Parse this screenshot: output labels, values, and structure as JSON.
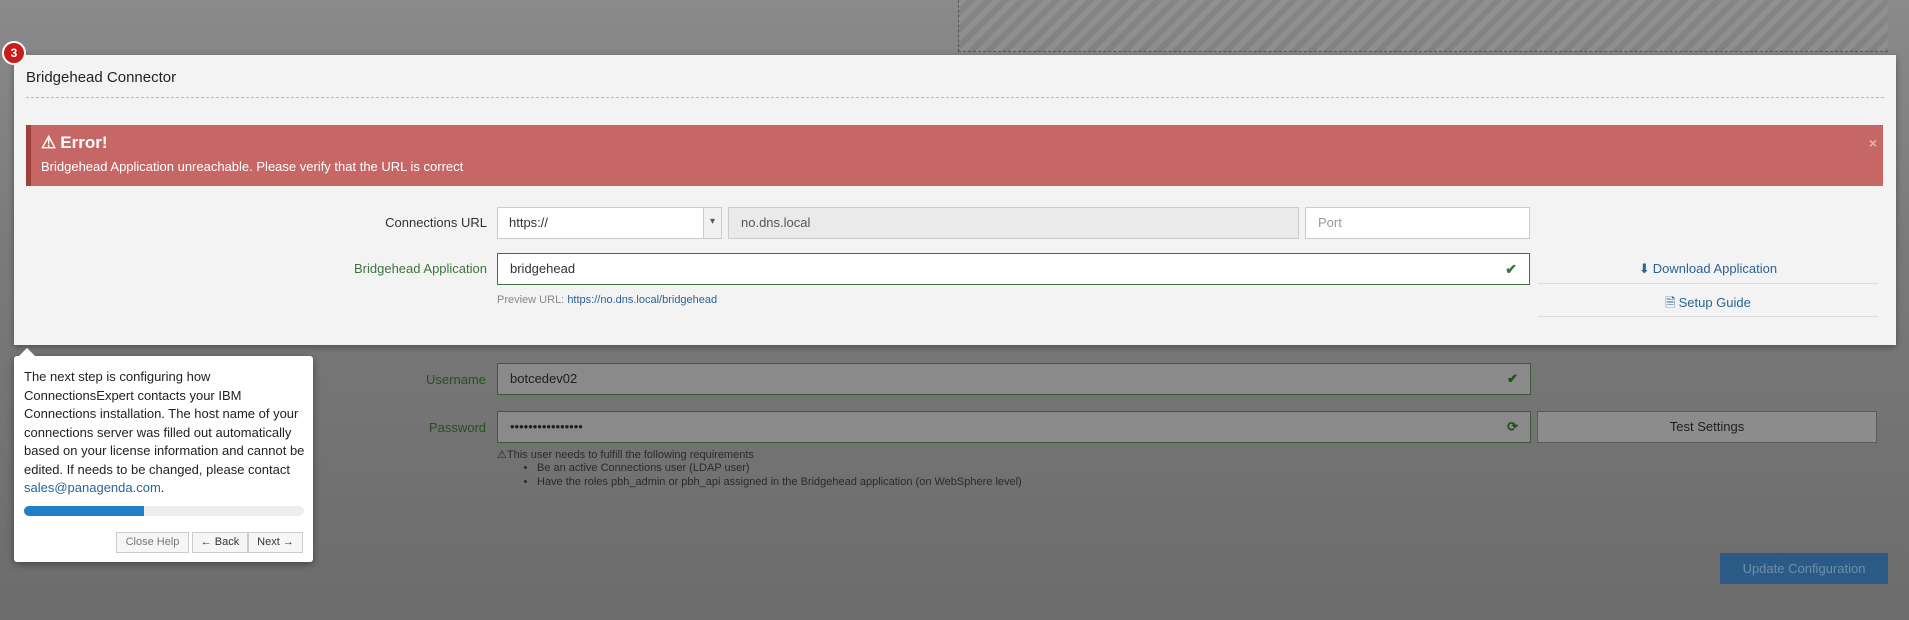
{
  "modal": {
    "step_badge": "3",
    "title": "Bridgehead Connector",
    "alert": {
      "title": "Error!",
      "message": "Bridgehead Application unreachable. Please verify that the URL is correct",
      "close": "×"
    },
    "connections_url": {
      "label": "Connections URL",
      "protocol": "https://",
      "host": "no.dns.local",
      "port_placeholder": "Port"
    },
    "bridgehead_app": {
      "label": "Bridgehead Application",
      "value": "bridgehead",
      "preview_label": "Preview URL:",
      "preview_url": "https://no.dns.local/bridgehead"
    },
    "side_links": {
      "download": "Download Application",
      "setup": "Setup Guide"
    }
  },
  "background_form": {
    "username_label": "Username",
    "username_value": "botcedev02",
    "password_label": "Password",
    "password_value": "••••••••••••••••",
    "test_button": "Test Settings",
    "requirements_intro": "This user needs to fulfill the following requirements",
    "requirements": [
      "Be an active Connections user (LDAP user)",
      "Have the roles pbh_admin or pbh_api assigned in the Bridgehead application (on WebSphere level)"
    ],
    "update_button": "Update Configuration"
  },
  "help": {
    "text": "The next step is configuring how ConnectionsExpert contacts your IBM Connections installation. The host name of your connections server was filled out automatically based on your license information and cannot be edited. If needs to be changed, please contact ",
    "email": "sales@panagenda.com",
    "text_end": ".",
    "progress_percent": 43,
    "close_button": "Close Help",
    "back_button": "← Back",
    "next_button": "Next →"
  },
  "colors": {
    "alert_bg": "#c66765",
    "link": "#2a6496",
    "success": "#3c763d",
    "progress": "#1f7fc7",
    "badge": "#cc1b1b"
  }
}
